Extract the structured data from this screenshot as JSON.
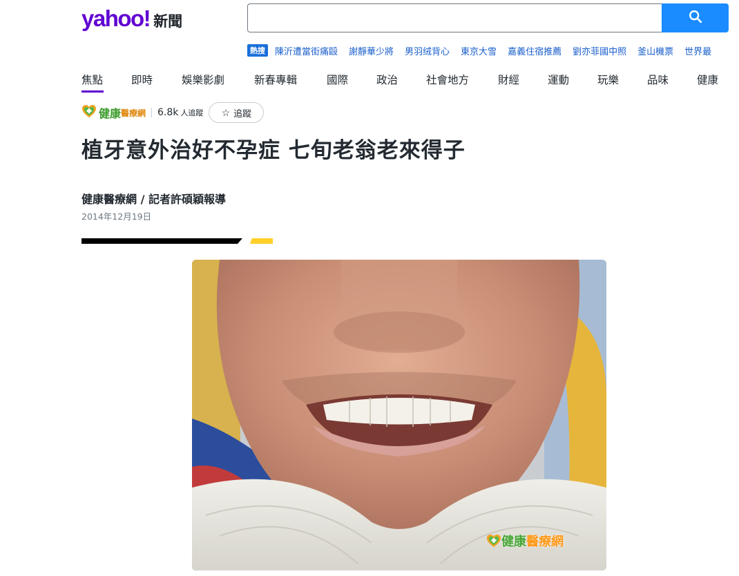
{
  "header": {
    "logo_brand": "yahoo!",
    "logo_section": "新聞",
    "search": {
      "placeholder": "",
      "value": ""
    }
  },
  "trending": {
    "badge": "熱搜",
    "items": [
      "陳沂遭當街痛毆",
      "謝靜華少將",
      "男羽绒背心",
      "東京大雪",
      "嘉義住宿推薦",
      "劉亦菲國中照",
      "釜山機票",
      "世界最"
    ]
  },
  "nav": {
    "items": [
      "焦點",
      "即時",
      "娛樂影劇",
      "新春專輯",
      "國際",
      "政治",
      "社會地方",
      "財經",
      "運動",
      "玩樂",
      "品味",
      "健康"
    ],
    "active": "焦點"
  },
  "provider": {
    "logo_text_part1": "健康",
    "logo_text_part2": "醫療網",
    "followers_count": "6.8k",
    "followers_label": "人追蹤",
    "follow_label": "追蹤"
  },
  "article": {
    "headline": "植牙意外治好不孕症 七旬老翁老來得子",
    "byline": "健康醫療網 / 記者許碩穎報導",
    "date": "2014年12月19日"
  },
  "photo": {
    "watermark_part1": "健康",
    "watermark_part2": "醫療網"
  },
  "colors": {
    "brand_purple": "#6001d2",
    "search_blue": "#1a8cff",
    "trending_badge": "#1a6fd9",
    "accent_yellow": "#ffd029"
  }
}
